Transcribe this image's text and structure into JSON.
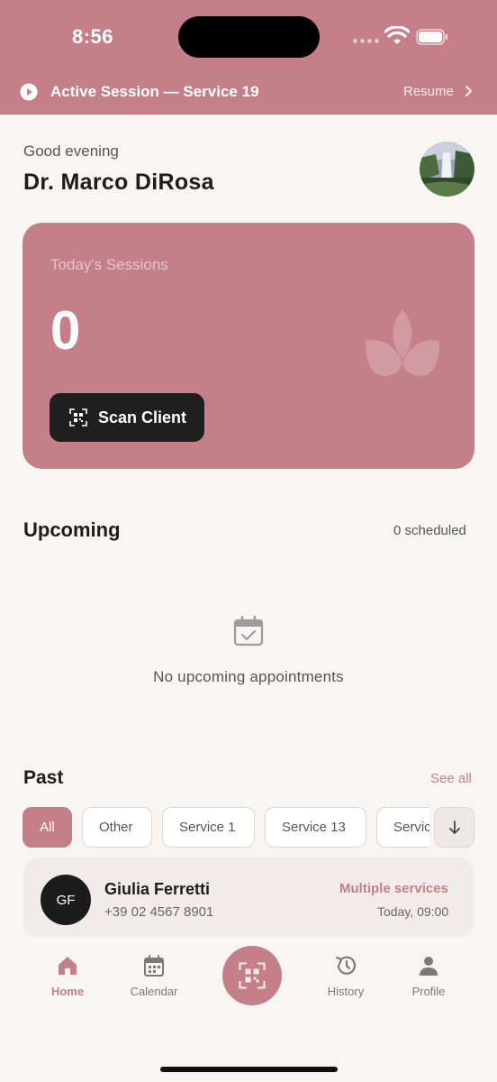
{
  "status_bar": {
    "time": "8:56"
  },
  "session_banner": {
    "text": "Active Session — Service 19",
    "resume_label": "Resume"
  },
  "greeting": {
    "salutation": "Good evening",
    "name": "Dr. Marco DiRosa"
  },
  "sessions_card": {
    "label": "Today's Sessions",
    "count": "0",
    "scan_label": "Scan Client"
  },
  "upcoming": {
    "title": "Upcoming",
    "count_label": "0 scheduled",
    "empty_text": "No upcoming appointments"
  },
  "past": {
    "title": "Past",
    "see_all": "See all",
    "filters": [
      "All",
      "Other",
      "Service 1",
      "Service 13",
      "Servic"
    ],
    "client": {
      "initials": "GF",
      "name": "Giulia Ferretti",
      "phone": "+39 02 4567 8901",
      "service": "Multiple services",
      "when": "Today, 09:00"
    }
  },
  "nav": {
    "home": "Home",
    "calendar": "Calendar",
    "history": "History",
    "profile": "Profile"
  },
  "colors": {
    "accent": "#c47f88",
    "background": "#f8f5f2",
    "dark": "#1f1f1f"
  }
}
